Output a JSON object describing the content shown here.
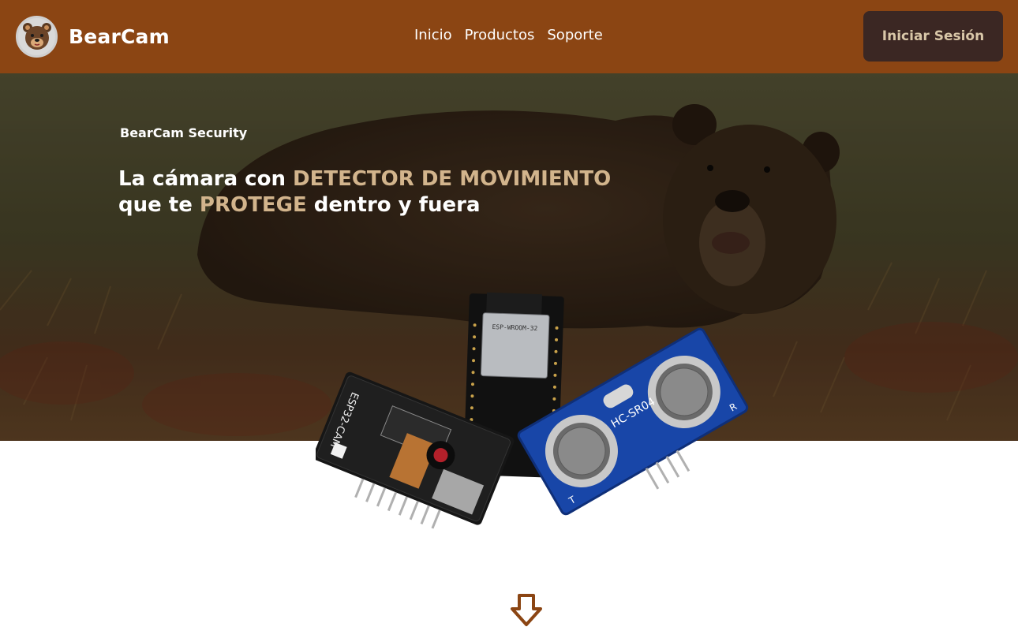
{
  "header": {
    "brand_name": "BearCam",
    "logo_icon": "bear-face-icon",
    "nav": [
      {
        "label": "Inicio"
      },
      {
        "label": "Productos"
      },
      {
        "label": "Soporte"
      }
    ],
    "login_label": "Iniciar Sesión"
  },
  "hero": {
    "eyebrow": "BearCam Security",
    "headline": {
      "part1": "La cámara con ",
      "highlight1": "DETECTOR DE MOVIMIENTO",
      "part2": " que te ",
      "highlight2": "PROTEGE",
      "part3": " dentro y fuera"
    }
  },
  "product_labels": {
    "camera_board": "ESP32-CAM",
    "sensor_board": "HC-SR04",
    "module": "ESP-WROOM-32",
    "sensor_t": "T",
    "sensor_r": "R"
  },
  "scroll_icon": "arrow-down-icon",
  "colors": {
    "header_bg": "#8b4513",
    "login_bg": "#3b2723",
    "login_text": "#d9c7a8",
    "highlight": "#d2b48c"
  }
}
